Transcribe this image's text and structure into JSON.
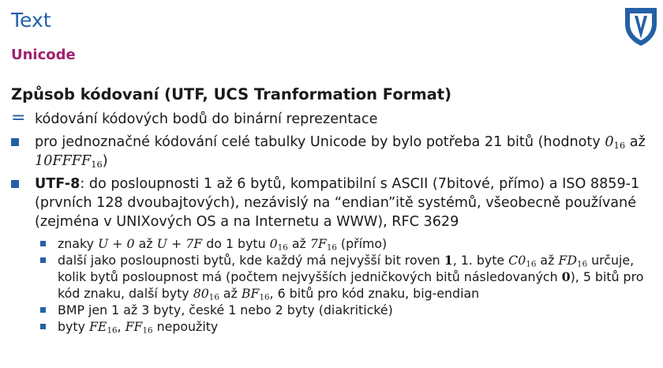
{
  "slide": {
    "title": "Text",
    "subtitle": "Unicode"
  },
  "content": {
    "heading": "Způsob kódovaní (UTF, UCS Tranformation Format)",
    "definition": "kódování kódových bodů do binární reprezentace",
    "bullet1": {
      "text_a": "pro jednoznačné kódování celé tabulky Unicode by bylo potřeba 21 bitů (hodnoty ",
      "val1": "0",
      "val1_sub": "16",
      "text_b": " až ",
      "val2": "10FFFF",
      "val2_sub": "16",
      "text_c": ")"
    },
    "bullet2": {
      "bold": "UTF-8",
      "text": ": do posloupnosti 1 až 6 bytů, kompatibilní s ASCII (7bitové, přímo) a ISO 8859-1 (prvních 128 dvoubajtových), nezávislý na “endian”itě systémů, všeobecně používané (zejména v UNIXových OS a na Internetu a WWW), RFC 3629",
      "sub1": {
        "t1": "znaky ",
        "m1": "U + 0",
        "t2": " až ",
        "m2": "U + 7F",
        "t3": " do 1 bytu ",
        "m3": "0",
        "m3_sub": "16",
        "t4": " až ",
        "m4": "7F",
        "m4_sub": "16",
        "t5": " (přímo)"
      },
      "sub2": {
        "t1": "další jako posloupnosti bytů, kde každý má nejvyšší bit roven ",
        "m1": "1",
        "t2": ", 1. byte ",
        "m2": "C0",
        "m2_sub": "16",
        "t3": " až ",
        "m3": "FD",
        "m3_sub": "16",
        "t4": " určuje, kolik bytů posloupnost má (počtem nejvyšších jedničkových bitů následovaných ",
        "m4": "0",
        "t5": "), 5 bitů pro kód znaku, další byty ",
        "m5": "80",
        "m5_sub": "16",
        "t6": " až ",
        "m6": "BF",
        "m6_sub": "16",
        "t7": ", 6 bitů pro kód znaku, big-endian"
      },
      "sub3": "BMP jen 1 až 3 byty, české 1 nebo 2 byty (diakritické)",
      "sub4": {
        "t1": "byty ",
        "m1": "FE",
        "m1_sub": "16",
        "t2": ", ",
        "m2": "FF",
        "m2_sub": "16",
        "t3": " nepoužity"
      }
    }
  },
  "logo": {
    "icon": "university-shield-logo",
    "color": "#2460a7"
  },
  "colors": {
    "title": "#2460a7",
    "subtitle": "#a0216f",
    "bullet": "#2460a7"
  }
}
